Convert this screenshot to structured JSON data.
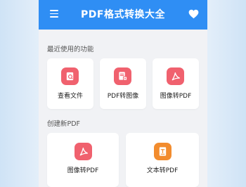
{
  "appbar": {
    "title": "PDF格式转换大全"
  },
  "recent": {
    "title": "最近使用的功能",
    "items": [
      {
        "label": "查看文件"
      },
      {
        "label": "PDF转图像"
      },
      {
        "label": "图像转PDF"
      }
    ]
  },
  "create": {
    "title": "创建新PDF",
    "items": [
      {
        "label": "图像转PDF"
      },
      {
        "label": "文本转PDF"
      }
    ]
  },
  "colors": {
    "primary": "#2f8ef4",
    "icon_red": "#f0616e",
    "icon_orange": "#f28c2e",
    "page_bg": "#f1f2f5"
  }
}
